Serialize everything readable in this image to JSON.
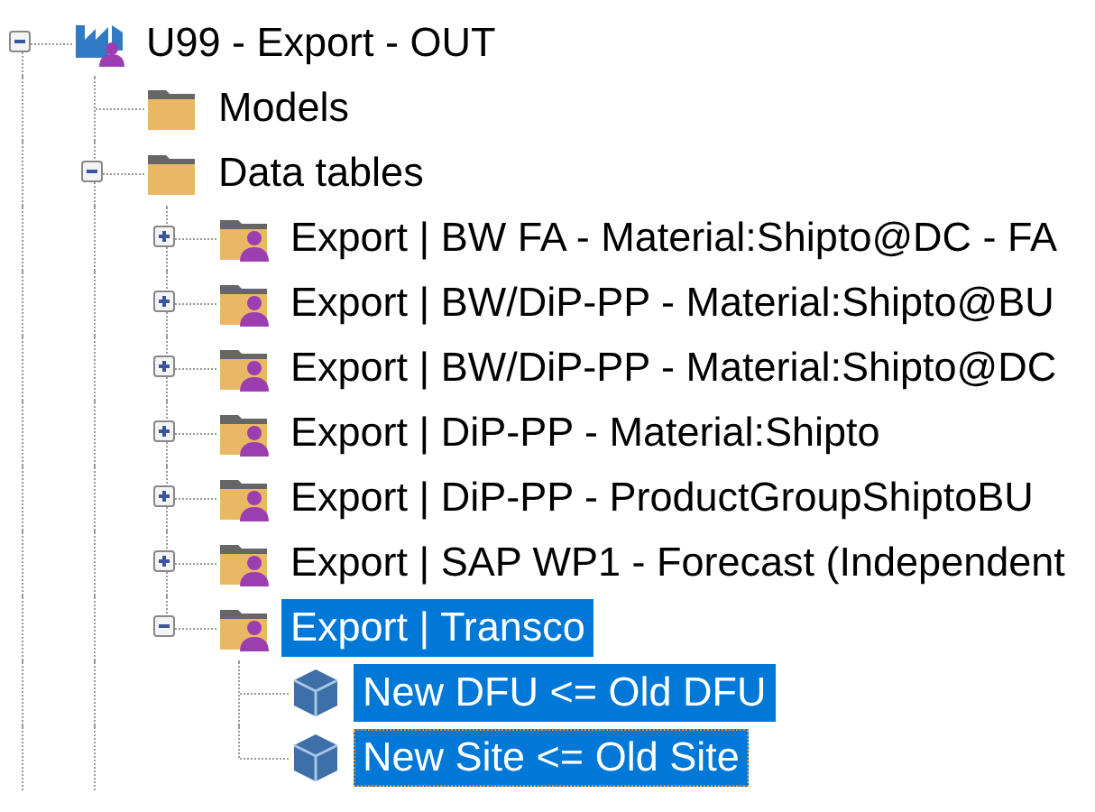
{
  "tree": {
    "nodes": [
      {
        "label": "U99 - Export - OUT",
        "kind": "project",
        "expanded": true,
        "selected": false,
        "focused": false,
        "children": [
          {
            "label": "Models",
            "kind": "folder",
            "selected": false,
            "focused": false
          },
          {
            "label": "Data tables",
            "kind": "folder",
            "expanded": true,
            "selected": false,
            "focused": false,
            "children": [
              {
                "label": "Export | BW FA - Material:Shipto@DC - FA",
                "kind": "shared-folder",
                "expanded": false,
                "selected": false,
                "focused": false
              },
              {
                "label": "Export | BW/DiP-PP - Material:Shipto@BU",
                "kind": "shared-folder",
                "expanded": false,
                "selected": false,
                "focused": false
              },
              {
                "label": "Export | BW/DiP-PP - Material:Shipto@DC",
                "kind": "shared-folder",
                "expanded": false,
                "selected": false,
                "focused": false
              },
              {
                "label": "Export | DiP-PP - Material:Shipto",
                "kind": "shared-folder",
                "expanded": false,
                "selected": false,
                "focused": false
              },
              {
                "label": "Export | DiP-PP - ProductGroupShiptoBU",
                "kind": "shared-folder",
                "expanded": false,
                "selected": false,
                "focused": false
              },
              {
                "label": "Export | SAP WP1 - Forecast (Independent",
                "kind": "shared-folder",
                "expanded": false,
                "selected": false,
                "focused": false
              },
              {
                "label": "Export | Transco",
                "kind": "shared-folder",
                "expanded": true,
                "selected": true,
                "focused": false,
                "children": [
                  {
                    "label": "New DFU <= Old DFU",
                    "kind": "table",
                    "selected": true,
                    "focused": false
                  },
                  {
                    "label": "New Site <= Old Site",
                    "kind": "table",
                    "selected": true,
                    "focused": true
                  }
                ]
              }
            ]
          }
        ]
      }
    ]
  }
}
